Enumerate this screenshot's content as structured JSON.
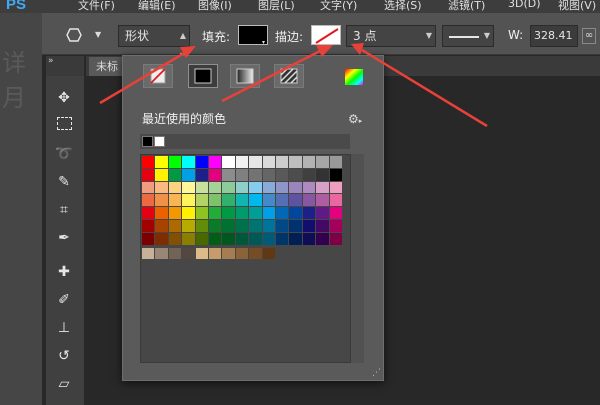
{
  "menubar": {
    "logo": "PS",
    "items": [
      "文件(F)",
      "编辑(E)",
      "图像(I)",
      "图层(L)",
      "文字(Y)",
      "选择(S)",
      "滤镜(T)",
      "3D(D)",
      "视图(V)"
    ]
  },
  "left_panel": {
    "ghost_text": "详月"
  },
  "options_bar": {
    "shape_mode": "形状",
    "fill_label": "填充:",
    "stroke_label": "描边:",
    "stroke_width": "3 点",
    "width_label": "W:",
    "width_value": "328.41"
  },
  "document_tab": {
    "label": "未标"
  },
  "toolbar": {
    "collapse_label": "»",
    "tools": [
      "move-tool",
      "marquee-tool",
      "lasso-tool",
      "quick-select-tool",
      "crop-tool",
      "eyedropper-tool",
      "healing-brush-tool",
      "brush-tool",
      "clone-stamp-tool",
      "history-brush-tool",
      "eraser-tool"
    ]
  },
  "popup": {
    "recent_title": "最近使用的颜色",
    "recent_colors": [
      "#000000",
      "#ffffff"
    ],
    "fill_types": [
      "no-color",
      "solid-color",
      "gradient",
      "pattern"
    ],
    "selected_fill_type": "solid-color",
    "swatch_rows": [
      [
        "#ff0000",
        "#ffff00",
        "#00ff00",
        "#00ffff",
        "#0000ff",
        "#ff00ff",
        "#ffffff",
        "#f2f2f2",
        "#e6e6e6",
        "#d9d9d9",
        "#cccccc",
        "#bfbfbf",
        "#b3b3b3",
        "#a6a6a6",
        "#999999"
      ],
      [
        "#e60012",
        "#fff100",
        "#009944",
        "#00a0e9",
        "#1d2088",
        "#e4007f",
        "#8c8c8c",
        "#808080",
        "#737373",
        "#666666",
        "#595959",
        "#4d4d4d",
        "#404040",
        "#333333",
        "#000000"
      ],
      [
        "#f29c7f",
        "#f9b980",
        "#fdd280",
        "#fff799",
        "#c8e09d",
        "#a6d395",
        "#8fcb9a",
        "#8ed0c9",
        "#85ccee",
        "#88abda",
        "#8e96c8",
        "#9a86bd",
        "#ae8bbe",
        "#d6a0c8",
        "#f09ebf"
      ],
      [
        "#ec6941",
        "#f19149",
        "#f8b551",
        "#fff45c",
        "#b3d465",
        "#80c269",
        "#32b16c",
        "#13b5b1",
        "#00b7ee",
        "#448aca",
        "#556fb5",
        "#5f52a0",
        "#8957a1",
        "#ae5da1",
        "#ea68a2"
      ],
      [
        "#e60012",
        "#eb6100",
        "#f39800",
        "#fff100",
        "#8fc31f",
        "#22ac38",
        "#009944",
        "#009b6b",
        "#009e96",
        "#00a0e9",
        "#0068b7",
        "#00479d",
        "#1d2088",
        "#601986",
        "#e4007f"
      ],
      [
        "#a40000",
        "#a84200",
        "#ac6a00",
        "#b7aa00",
        "#638c0b",
        "#097c25",
        "#007130",
        "#00724b",
        "#007471",
        "#00749b",
        "#004986",
        "#00326f",
        "#120e6f",
        "#430965",
        "#a4005b"
      ],
      [
        "#7d0000",
        "#7f2d00",
        "#834f00",
        "#8a7f00",
        "#4a6800",
        "#005e15",
        "#005820",
        "#00573b",
        "#005956",
        "#005a79",
        "#003567",
        "#001f55",
        "#100c56",
        "#330050",
        "#7e0046"
      ],
      [
        "#c7b299",
        "#998675",
        "#736357",
        "#534741",
        "#ddbb88",
        "#c69c6d",
        "#a67c52",
        "#8c6239",
        "#754c24",
        "#603813"
      ]
    ]
  }
}
